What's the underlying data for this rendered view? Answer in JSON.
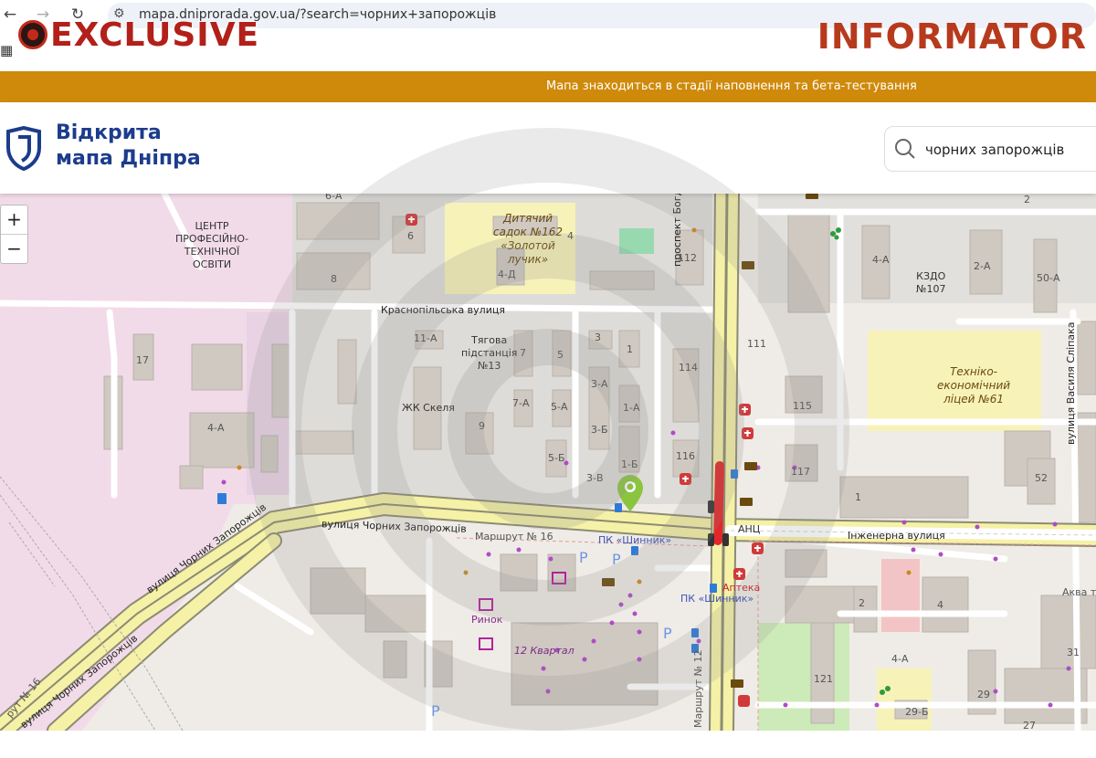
{
  "browser": {
    "url": "mapa.dniprorada.gov.ua/?search=чорних+запорожців"
  },
  "overlay": {
    "left_brand": "EXCLUSIVE",
    "right_brand": "INFORMATOR"
  },
  "banner": {
    "text": "Мапа знаходиться в стадії наповнення та бета-тестування"
  },
  "header": {
    "logo_line1": "Відкрита",
    "logo_line2": "мапа Дніпра",
    "search_value": "чорних запорожців"
  },
  "zoom": {
    "plus": "+",
    "minus": "−"
  },
  "map_labels": {
    "center_prof": "ЦЕНТР\nПРОФЕСІЙНО-\nТЕХНІЧНОЇ\nОСВІТИ",
    "kindergarten": "Дитячий\nсадок №162\n«Золотой\nлучик»",
    "krasnopilska": "Краснопільська вулиця",
    "tyagova": "Тягова\nпідстанція\n№13",
    "zhk_skelya": "ЖК Скеля",
    "kzdo": "КЗДО\n№107",
    "lyceum": "Техніко-\nекономічний\nліцей №61",
    "prospekt": "проспект Богдана Хмельницького",
    "vasylya": "вулиця Василя Сліпака",
    "chornykh_main": "вулиця Чорних Запорожців",
    "chornykh_diag": "вулиця Чорних Запорожців",
    "chornykh_diag2": "вулиця Чорних Запорожців",
    "marshrut16": "Маршрут № 16",
    "marshrut16b": "рут № 16",
    "marshrut12": "Маршрут № 12",
    "pk_shynnyk1": "ПК «Шинник»",
    "pk_shynnyk2": "ПК «Шинник»",
    "apteka": "Аптека",
    "anc": "АНЦ",
    "inzhenerna": "Інженерна вулиця",
    "rynok": "Ринок",
    "kvartal": "12 Квартал",
    "akva": "Аква та",
    "numbers": [
      "6-А",
      "6",
      "2",
      "4",
      "4-Д",
      "112",
      "8",
      "4-А",
      "2-А",
      "50-А",
      "11-А",
      "7",
      "5",
      "3",
      "1",
      "114",
      "17",
      "111",
      "3-А",
      "7-А",
      "5-А",
      "1-А",
      "115",
      "9",
      "3-Б",
      "4-А",
      "5-Б",
      "116",
      "117",
      "52",
      "1-Б",
      "3-В",
      "1",
      "2",
      "4",
      "4-А",
      "121",
      "29",
      "29-Б",
      "31",
      "27"
    ]
  },
  "colors": {
    "banner": "#cf8a0b",
    "logo_blue": "#1c3c8c",
    "residential": "#f2dbe8",
    "primary_road": "#f5f1a6",
    "marker_green": "#8bc53f",
    "traffic_red": "#e2262a"
  }
}
